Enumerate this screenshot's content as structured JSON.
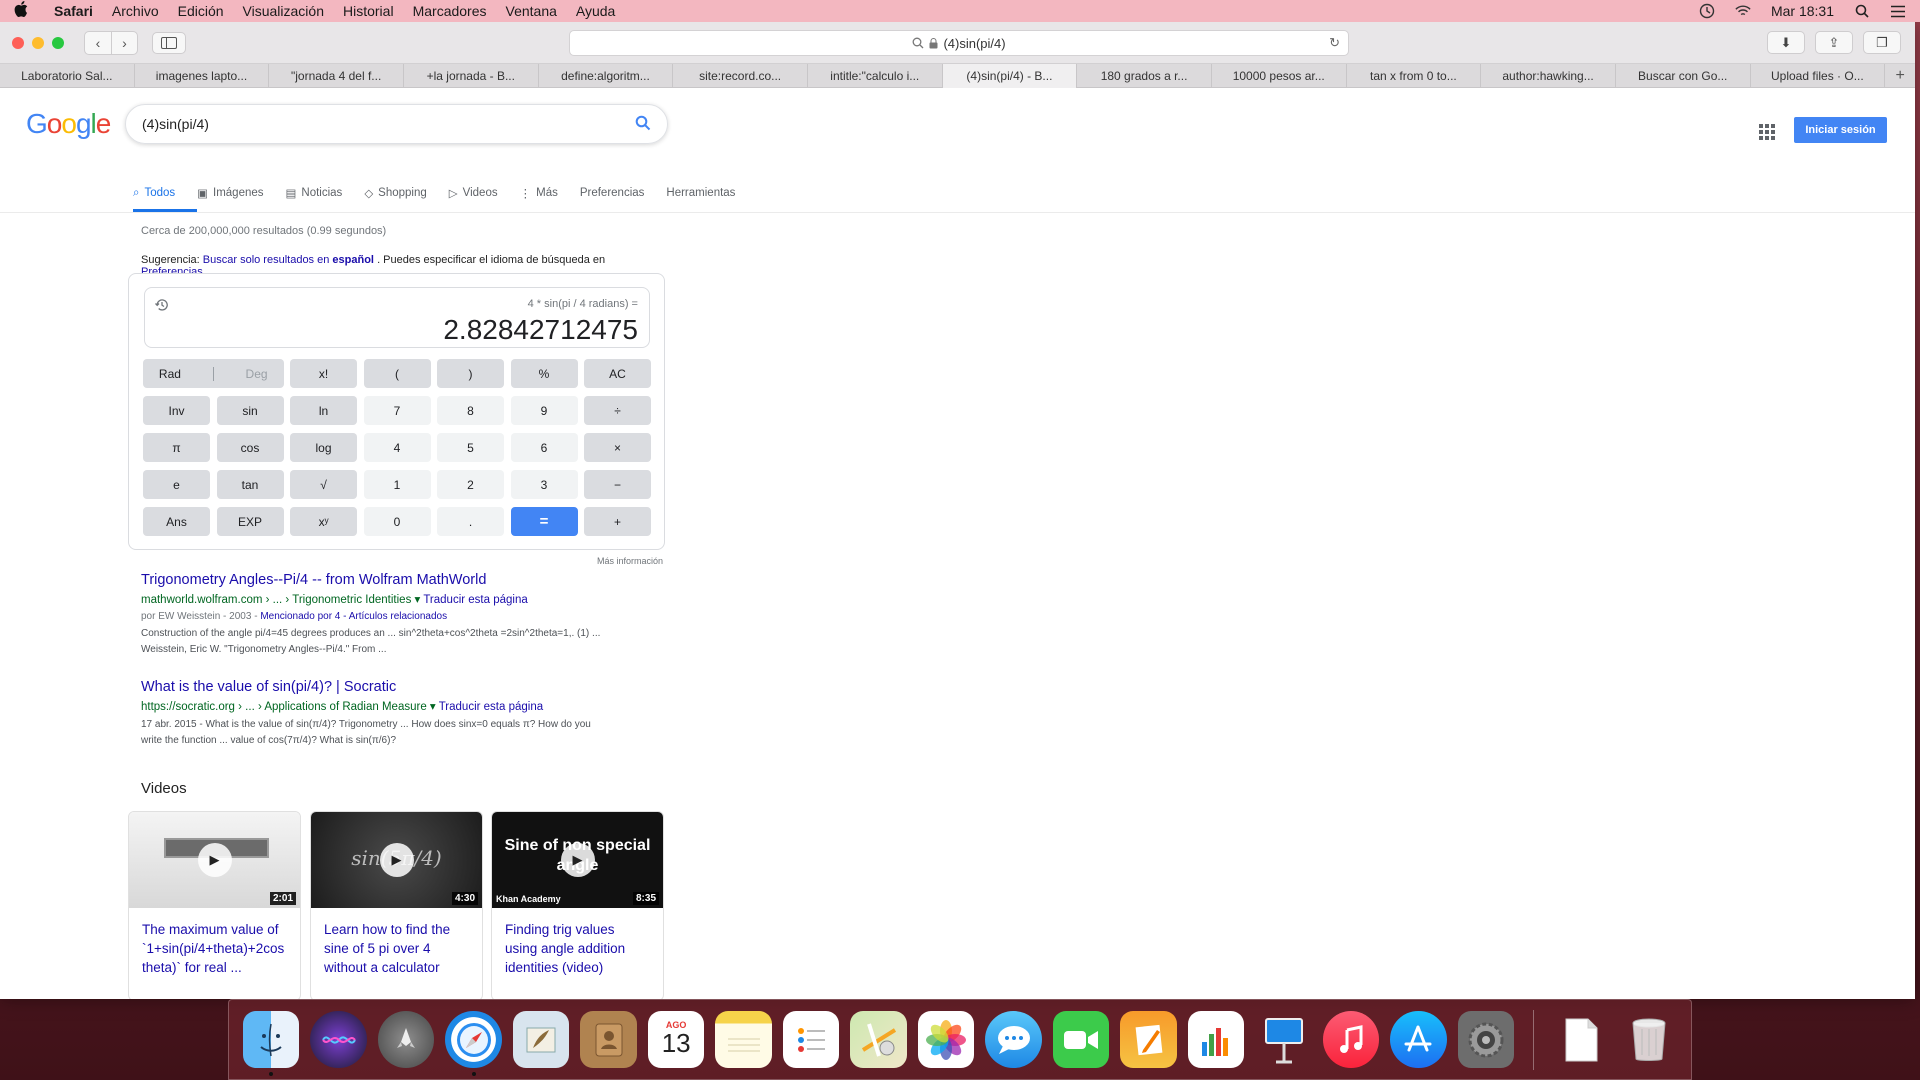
{
  "menubar": {
    "app_name": "Safari",
    "items": [
      "Archivo",
      "Edición",
      "Visualización",
      "Historial",
      "Marcadores",
      "Ventana",
      "Ayuda"
    ],
    "clock": "Mar 18:31"
  },
  "browser": {
    "address": "(4)sin(pi/4)",
    "tabs": [
      "Laboratorio Sal...",
      "imagenes lapto...",
      "\"jornada 4 del f...",
      "+la jornada - B...",
      "define:algoritm...",
      "site:record.co...",
      "intitle:\"calculo i...",
      "(4)sin(pi/4) - B...",
      "180 grados a r...",
      "10000 pesos ar...",
      "tan x from 0 to...",
      "author:hawking...",
      "Buscar con Go...",
      "Upload files · O..."
    ],
    "active_tab_index": 7
  },
  "google": {
    "logo": "Google",
    "query": "(4)sin(pi/4)",
    "signin": "Iniciar sesión",
    "nav_tabs": [
      "Todos",
      "Imágenes",
      "Noticias",
      "Shopping",
      "Videos",
      "Más",
      "Preferencias",
      "Herramientas"
    ],
    "results_count": "Cerca de 200,000,000 resultados (0.99 segundos)",
    "suggestion": {
      "prefix": "Sugerencia:",
      "link": "Buscar solo resultados en",
      "language": "español",
      "rest": ". Puedes especificar el idioma de búsqueda en",
      "prefs_link": "Preferencias"
    }
  },
  "calculator": {
    "expression": "4 * sin(pi / 4 radians) =",
    "result": "2.82842712475",
    "keys": [
      [
        "Rad|Deg",
        "x!",
        "(",
        ")",
        "%",
        "AC"
      ],
      [
        "Inv",
        "sin",
        "ln",
        "7",
        "8",
        "9",
        "÷"
      ],
      [
        "π",
        "cos",
        "log",
        "4",
        "5",
        "6",
        "×"
      ],
      [
        "e",
        "tan",
        "√",
        "1",
        "2",
        "3",
        "−"
      ],
      [
        "Ans",
        "EXP",
        "xʸ",
        "0",
        ".",
        "=",
        "+"
      ]
    ],
    "rad": "Rad",
    "deg": "Deg",
    "more_info": "Más información"
  },
  "results": [
    {
      "title": "Trigonometry Angles--Pi/4 -- from Wolfram MathWorld",
      "cite": "mathworld.wolfram.com › ... › Trigonometric Identities",
      "translate": "Traducir esta página",
      "meta_prefix": "por EW Weisstein - 2003 -",
      "meta_links": "Mencionado por 4 - Artículos relacionados",
      "snippet_line1": "Construction of the angle pi/4=45 degrees produces an ... sin^2theta+cos^2theta =2sin^2theta=1,. (1) ...",
      "snippet_line2": "Weisstein, Eric W. \"Trigonometry Angles--Pi/4.\" From ..."
    },
    {
      "title": "What is the value of sin(pi/4)? | Socratic",
      "cite": "https://socratic.org › ... › Applications of Radian Measure",
      "translate": "Traducir esta página",
      "snippet_line1": "17 abr. 2015 - What is the value of sin(π/4)? Trigonometry ... How does sinx=0 equals π? How do you",
      "snippet_line2": "write the function ... value of cos(7π/4)? What is sin(π/6)?"
    }
  ],
  "videos": {
    "heading": "Videos",
    "items": [
      {
        "label": "The maximum value of `1+sin(pi/4+theta)+2cos theta)` for real ...",
        "duration": "2:01",
        "thumb_text": ""
      },
      {
        "label": "Learn how to find the sine of 5 pi over 4 without a calculator",
        "duration": "4:30",
        "thumb_text": "sin(5π/4)"
      },
      {
        "label": "Finding trig values using angle addition identities (video)",
        "duration": "8:35",
        "thumb_text": "Sine of non special angle",
        "channel": "Khan Academy"
      }
    ]
  },
  "dock": {
    "apps": [
      "finder-icon",
      "siri-icon",
      "launchpad-icon",
      "safari-icon",
      "mail-icon",
      "contacts-icon",
      "calendar-icon",
      "notes-icon",
      "reminders-icon",
      "maps-icon",
      "photos-icon",
      "messages-icon",
      "facetime-icon",
      "pages-icon",
      "numbers-icon",
      "keynote-icon",
      "itunes-icon",
      "app-store-icon",
      "system-preferences-icon"
    ],
    "calendar_month": "AGO",
    "calendar_day": "13"
  }
}
